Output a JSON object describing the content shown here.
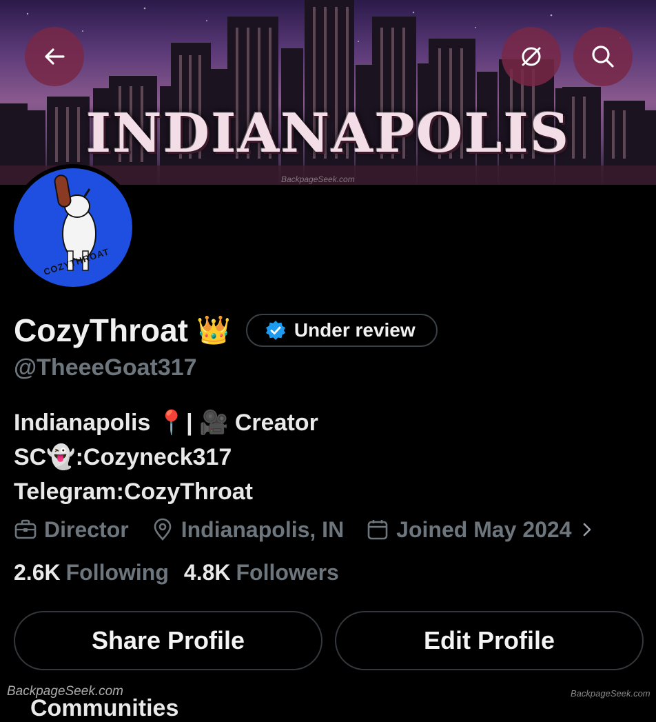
{
  "banner": {
    "title": "INDIANAPOLIS",
    "watermark": "BackpageSeek.com"
  },
  "header": {
    "back_icon": "arrow-left-icon",
    "translate_icon": "globe-slash-icon",
    "search_icon": "search-icon"
  },
  "profile": {
    "name": "CozyThroat",
    "name_emoji": "👑",
    "verification_label": "Under review",
    "handle": "@TheeeGoat317",
    "avatar_text": "COZYTHROAT",
    "bio": [
      "Indianapolis 📍| 🎥 Creator",
      "SC👻:Cozyneck317",
      "Telegram:CozyThroat"
    ],
    "meta": {
      "profession": "Director",
      "location": "Indianapolis, IN",
      "joined": "Joined May 2024"
    },
    "stats": {
      "following_count": "2.6K",
      "following_label": "Following",
      "followers_count": "4.8K",
      "followers_label": "Followers"
    }
  },
  "actions": {
    "share_label": "Share Profile",
    "edit_label": "Edit Profile"
  },
  "next_section": "Communities",
  "watermarks": {
    "left": "BackpageSeek.com",
    "right": "BackpageSeek.com"
  },
  "colors": {
    "background": "#000000",
    "muted_text": "#6e767d",
    "verified_blue": "#1d9bf0",
    "avatar_bg": "#1e4fe0",
    "header_button": "#782846"
  }
}
